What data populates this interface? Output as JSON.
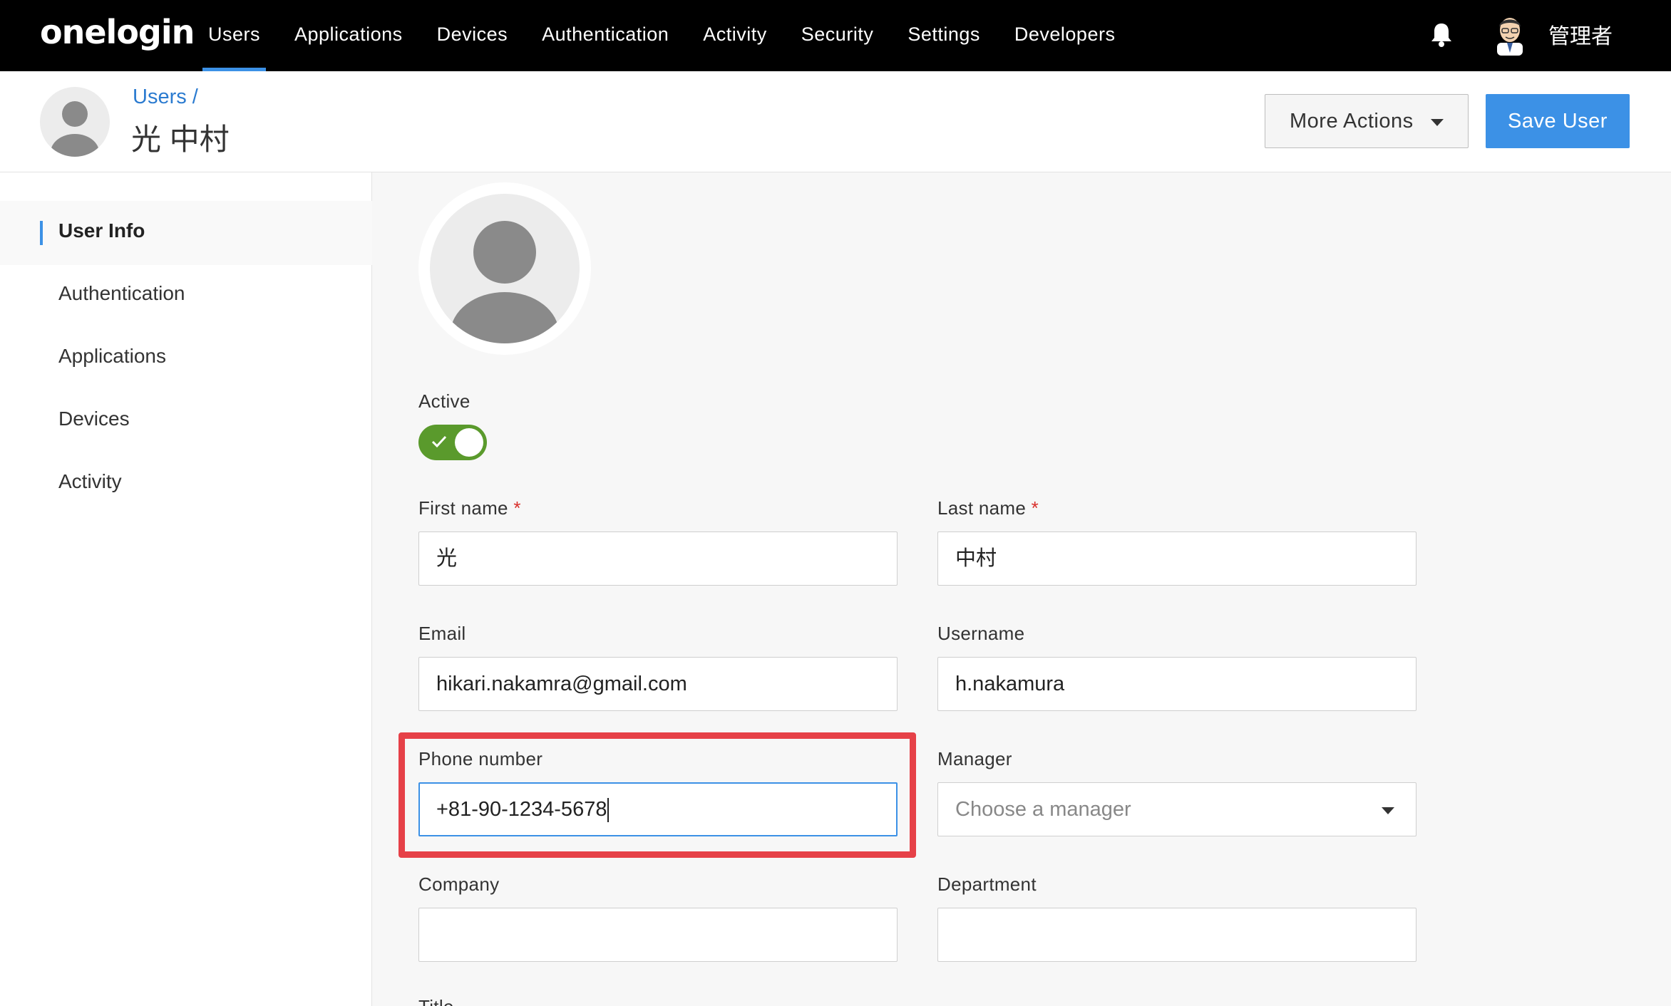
{
  "nav": {
    "logo": "onelogin",
    "items": [
      "Users",
      "Applications",
      "Devices",
      "Authentication",
      "Activity",
      "Security",
      "Settings",
      "Developers"
    ],
    "active_index": 0,
    "admin_name": "管理者"
  },
  "header": {
    "breadcrumb": "Users",
    "breadcrumb_sep": "/",
    "title": "光 中村",
    "more_actions_label": "More Actions",
    "save_label": "Save User"
  },
  "sidebar": {
    "items": [
      "User Info",
      "Authentication",
      "Applications",
      "Devices",
      "Activity"
    ],
    "active_index": 0
  },
  "form": {
    "active_label": "Active",
    "active_value": true,
    "first_name": {
      "label": "First name",
      "required_mark": "*",
      "value": "光"
    },
    "last_name": {
      "label": "Last name",
      "required_mark": "*",
      "value": "中村"
    },
    "email": {
      "label": "Email",
      "value": "hikari.nakamra@gmail.com"
    },
    "username": {
      "label": "Username",
      "value": "h.nakamura"
    },
    "phone": {
      "label": "Phone number",
      "value": "+81-90-1234-5678"
    },
    "manager": {
      "label": "Manager",
      "placeholder": "Choose a manager"
    },
    "company": {
      "label": "Company",
      "value": ""
    },
    "department": {
      "label": "Department",
      "value": ""
    },
    "title_label": "Title"
  },
  "colors": {
    "accent": "#3c91e6",
    "toggle_on": "#5a9a2c",
    "highlight": "#e64148",
    "required": "#d9302c"
  },
  "icons": {
    "bell": "bell-icon",
    "caret": "chevron-down-icon",
    "avatar": "user-avatar-icon",
    "check": "check-icon"
  }
}
